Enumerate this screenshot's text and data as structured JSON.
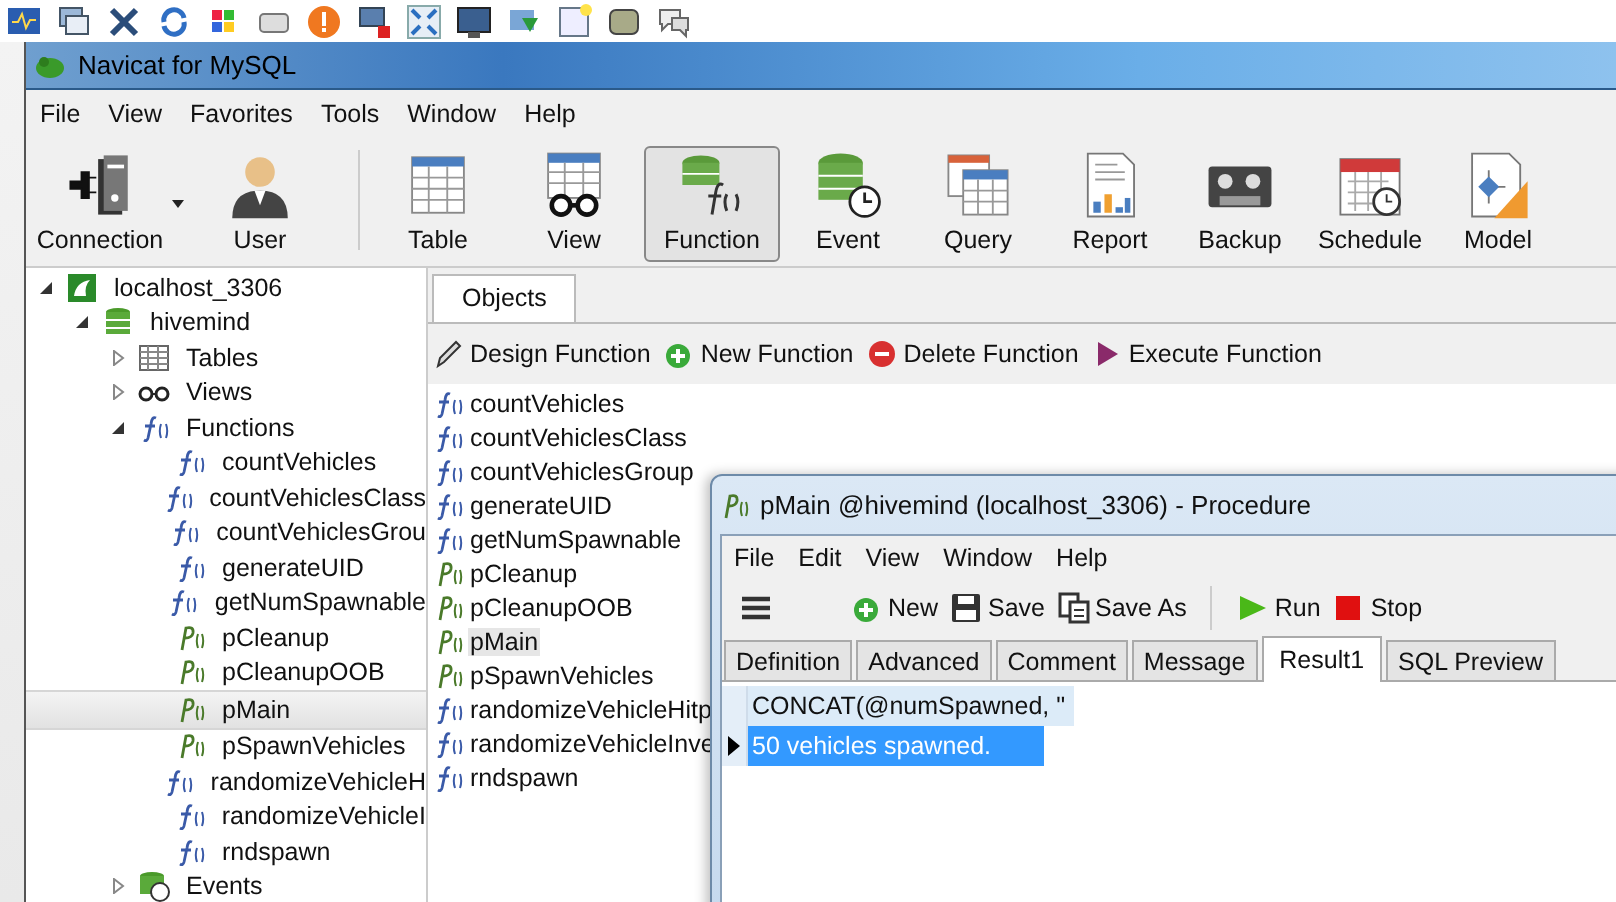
{
  "window": {
    "title": "Navicat for MySQL"
  },
  "menu": [
    "File",
    "View",
    "Favorites",
    "Tools",
    "Window",
    "Help"
  ],
  "toolbar": [
    {
      "label": "Connection",
      "kind": "connection",
      "selected": false
    },
    {
      "label": "User",
      "kind": "user",
      "selected": false
    },
    {
      "label": "Table",
      "kind": "table",
      "selected": false
    },
    {
      "label": "View",
      "kind": "view",
      "selected": false
    },
    {
      "label": "Function",
      "kind": "function",
      "selected": true
    },
    {
      "label": "Event",
      "kind": "event",
      "selected": false
    },
    {
      "label": "Query",
      "kind": "query",
      "selected": false
    },
    {
      "label": "Report",
      "kind": "report",
      "selected": false
    },
    {
      "label": "Backup",
      "kind": "backup",
      "selected": false
    },
    {
      "label": "Schedule",
      "kind": "schedule",
      "selected": false
    },
    {
      "label": "Model",
      "kind": "model",
      "selected": false
    }
  ],
  "sidebar": {
    "tree": [
      {
        "label": "localhost_3306",
        "kind": "server",
        "expanded": true,
        "selected": false,
        "children": [
          {
            "label": "hivemind",
            "kind": "database",
            "expanded": true,
            "selected": false,
            "children": [
              {
                "label": "Tables",
                "kind": "tables",
                "expanded": false,
                "selected": false
              },
              {
                "label": "Views",
                "kind": "views",
                "expanded": false,
                "selected": false
              },
              {
                "label": "Functions",
                "kind": "functions",
                "expanded": true,
                "selected": false,
                "children": [
                  {
                    "label": "countVehicles",
                    "kind": "function",
                    "selected": false
                  },
                  {
                    "label": "countVehiclesClass",
                    "kind": "function",
                    "selected": false
                  },
                  {
                    "label": "countVehiclesGrou",
                    "kind": "function",
                    "selected": false
                  },
                  {
                    "label": "generateUID",
                    "kind": "function",
                    "selected": false
                  },
                  {
                    "label": "getNumSpawnable",
                    "kind": "function",
                    "selected": false
                  },
                  {
                    "label": "pCleanup",
                    "kind": "procedure",
                    "selected": false
                  },
                  {
                    "label": "pCleanupOOB",
                    "kind": "procedure",
                    "selected": false
                  },
                  {
                    "label": "pMain",
                    "kind": "procedure",
                    "selected": true
                  },
                  {
                    "label": "pSpawnVehicles",
                    "kind": "procedure",
                    "selected": false
                  },
                  {
                    "label": "randomizeVehicleH",
                    "kind": "function",
                    "selected": false
                  },
                  {
                    "label": "randomizeVehicleI",
                    "kind": "function",
                    "selected": false
                  },
                  {
                    "label": "rndspawn",
                    "kind": "function",
                    "selected": false
                  }
                ]
              },
              {
                "label": "Events",
                "kind": "events",
                "expanded": false,
                "selected": false
              }
            ]
          }
        ]
      }
    ]
  },
  "objects": {
    "tabs": [
      {
        "label": "Objects",
        "selected": true
      }
    ],
    "actions": [
      {
        "label": "Design Function",
        "kind": "design"
      },
      {
        "label": "New Function",
        "kind": "new"
      },
      {
        "label": "Delete Function",
        "kind": "delete"
      },
      {
        "label": "Execute Function",
        "kind": "execute"
      }
    ],
    "items": [
      {
        "name": "countVehicles",
        "kind": "function",
        "selected": false
      },
      {
        "name": "countVehiclesClass",
        "kind": "function",
        "selected": false
      },
      {
        "name": "countVehiclesGroup",
        "kind": "function",
        "selected": false
      },
      {
        "name": "generateUID",
        "kind": "function",
        "selected": false
      },
      {
        "name": "getNumSpawnable",
        "kind": "function",
        "selected": false
      },
      {
        "name": "pCleanup",
        "kind": "procedure",
        "selected": false
      },
      {
        "name": "pCleanupOOB",
        "kind": "procedure",
        "selected": false
      },
      {
        "name": "pMain",
        "kind": "procedure",
        "selected": true
      },
      {
        "name": "pSpawnVehicles",
        "kind": "procedure",
        "selected": false
      },
      {
        "name": "randomizeVehicleHitp",
        "kind": "function",
        "selected": false
      },
      {
        "name": "randomizeVehicleInve",
        "kind": "function",
        "selected": false
      },
      {
        "name": "rndspawn",
        "kind": "function",
        "selected": false
      }
    ]
  },
  "procedure_window": {
    "title": "pMain @hivemind (localhost_3306) - Procedure",
    "menu": [
      "File",
      "Edit",
      "View",
      "Window",
      "Help"
    ],
    "toolbar": [
      {
        "label": "New",
        "kind": "new"
      },
      {
        "label": "Save",
        "kind": "save"
      },
      {
        "label": "Save As",
        "kind": "saveas"
      },
      {
        "label": "Run",
        "kind": "run"
      },
      {
        "label": "Stop",
        "kind": "stop"
      }
    ],
    "tabs": [
      {
        "label": "Definition",
        "selected": false
      },
      {
        "label": "Advanced",
        "selected": false
      },
      {
        "label": "Comment",
        "selected": false
      },
      {
        "label": "Message",
        "selected": false
      },
      {
        "label": "Result1",
        "selected": true
      },
      {
        "label": "SQL Preview",
        "selected": false
      }
    ],
    "grid": {
      "columns": [
        "CONCAT(@numSpawned, \""
      ],
      "rows": [
        {
          "cells": [
            "50 vehicles spawned."
          ],
          "selected": true
        }
      ]
    }
  }
}
